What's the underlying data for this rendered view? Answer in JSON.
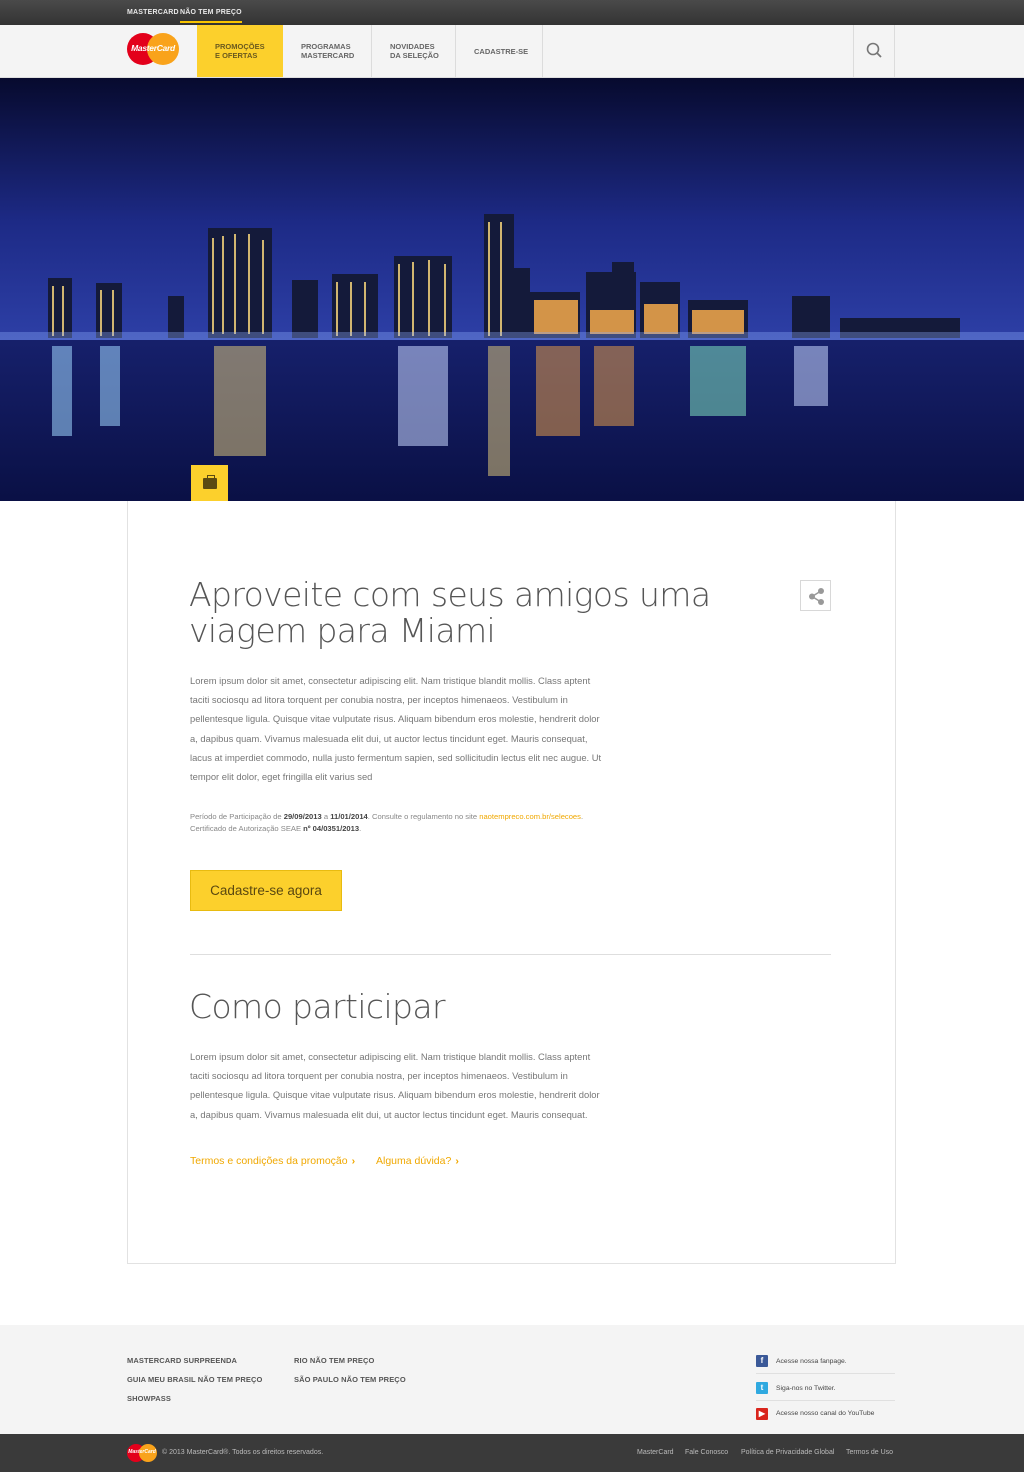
{
  "topbar": {
    "links": [
      "MASTERCARD",
      "NÃO TEM PREÇO"
    ]
  },
  "nav": {
    "logo_text": "MasterCard",
    "items": [
      {
        "label": "PROMOÇÕES\nE OFERTAS"
      },
      {
        "label": "PROGRAMAS\nMASTERCARD"
      },
      {
        "label": "NOVIDADES\nDA SELEÇÃO"
      },
      {
        "label": "CADASTRE-SE"
      }
    ]
  },
  "colors": {
    "accent": "#fcd02c",
    "link": "#f0a800",
    "topbar": "#3a3a3a"
  },
  "icons": {
    "search": "search-icon",
    "badge": "briefcase-icon",
    "share": "share-icon",
    "facebook": "facebook-icon",
    "twitter": "twitter-icon",
    "youtube": "youtube-icon"
  },
  "article": {
    "title": "Aproveite com seus amigos uma viagem para Miami",
    "body": "Lorem ipsum dolor sit amet, consectetur adipiscing elit. Nam tristique blandit mollis. Class aptent taciti sociosqu ad litora torquent per conubia nostra, per inceptos himenaeos. Vestibulum in pellentesque ligula. Quisque vitae vulputate risus. Aliquam bibendum eros molestie, hendrerit dolor a, dapibus quam. Vivamus malesuada elit dui, ut auctor lectus tincidunt eget. Mauris consequat, lacus at imperdiet commodo, nulla justo fermentum sapien, sed sollicitudin lectus elit nec augue. Ut tempor elit dolor, eget fringilla elit varius sed",
    "legal": {
      "prefix": "Período de Participação de ",
      "start": "29/09/2013",
      "mid": " a ",
      "end": "11/01/2014",
      "consult": ". Consulte o regulamento no site ",
      "site": "naotempreco.com.br/selecoes",
      "dot": ".",
      "cert_prefix": "Certificado de Autorização SEAE ",
      "cert": "nº 04/0351/2013",
      "cert_dot": "."
    },
    "cta": "Cadastre-se agora"
  },
  "how": {
    "title": "Como participar",
    "body": "Lorem ipsum dolor sit amet, consectetur adipiscing elit. Nam tristique blandit mollis. Class aptent taciti sociosqu ad litora torquent per conubia nostra, per inceptos himenaeos. Vestibulum in pellentesque ligula. Quisque vitae vulputate risus. Aliquam bibendum eros molestie, hendrerit dolor a, dapibus quam. Vivamus malesuada elit dui, ut auctor lectus tincidunt eget. Mauris consequat.",
    "links": [
      "Termos e condições da promoção",
      "Alguma dúvida?"
    ],
    "chevron": "›"
  },
  "footer": {
    "col1": [
      "MASTERCARD SURPREENDA",
      "GUIA MEU BRASIL NÃO TEM PREÇO",
      "SHOWPASS"
    ],
    "col2": [
      "RIO NÃO TEM PREÇO",
      "SÃO PAULO NÃO TEM PREÇO"
    ],
    "social": [
      "Acesse nossa fanpage.",
      "Siga-nos no Twitter.",
      "Acesse nosso canal do YouTube"
    ]
  },
  "bottom": {
    "logo_text": "MasterCard",
    "copyright": "© 2013 MasterCard®. Todos os direitos reservados.",
    "links": [
      "MasterCard",
      "Fale Conosco",
      "Política de Privacidade Global",
      "Termos de Uso"
    ]
  }
}
